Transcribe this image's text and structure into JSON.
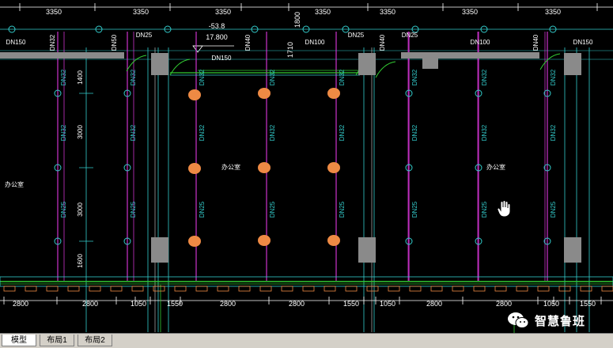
{
  "drawing": {
    "top_dims": [
      "3350",
      "3350",
      "3350",
      "1800",
      "3350",
      "3350",
      "3350",
      "3350"
    ],
    "bottom_dims": [
      "2800",
      "2800",
      "1050",
      "1550",
      "2800",
      "2800",
      "1550",
      "1050",
      "2800",
      "2800",
      "1050",
      "1550"
    ],
    "left_dims": [
      "1400",
      "3000",
      "3000",
      "1600"
    ],
    "top_right_dims": [
      "1710"
    ],
    "elevation": {
      "top": "-53.8",
      "bottom": "17.800"
    },
    "header_labels": [
      "DN150",
      "DN32",
      "DN50",
      "DN25",
      "DN40",
      "DN100",
      "DN25",
      "DN40",
      "DN25",
      "DN100",
      "DN40",
      "DN150"
    ],
    "main_label": "DN150",
    "pipe_labels_row1": [
      "DN32",
      "DN32",
      "DN32",
      "DN32",
      "DN32",
      "DN32",
      "DN32",
      "DN32"
    ],
    "pipe_labels_row2": [
      "DN32",
      "DN32",
      "DN32",
      "DN32",
      "DN32",
      "DN32",
      "DN32",
      "DN32"
    ],
    "pipe_labels_row3": [
      "DN25",
      "DN25",
      "DN25",
      "DN25",
      "DN25",
      "DN25",
      "DN25",
      "DN25"
    ],
    "room_labels": [
      "办公室",
      "办公室",
      "办公室"
    ]
  },
  "tabs": [
    "模型",
    "布局1",
    "布局2"
  ],
  "watermark": {
    "text": "智慧鲁班",
    "icon": "wechat-icon"
  },
  "cursor": {
    "icon": "hand-cursor-icon"
  },
  "colors": {
    "background": "#000000",
    "magenta": "#cc33cc",
    "cyan": "#33cccc",
    "green": "#33cc33",
    "orange": "#ee8a44",
    "text": "#ffffff",
    "column": "#8a8a8a"
  }
}
